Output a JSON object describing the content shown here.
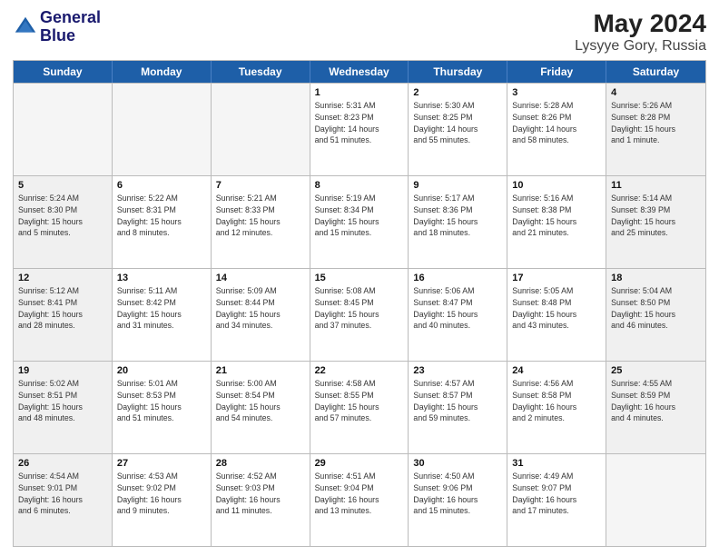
{
  "logo": {
    "line1": "General",
    "line2": "Blue"
  },
  "title": "May 2024",
  "location": "Lysyye Gory, Russia",
  "weekdays": [
    "Sunday",
    "Monday",
    "Tuesday",
    "Wednesday",
    "Thursday",
    "Friday",
    "Saturday"
  ],
  "rows": [
    [
      {
        "day": "",
        "info": "",
        "empty": true
      },
      {
        "day": "",
        "info": "",
        "empty": true
      },
      {
        "day": "",
        "info": "",
        "empty": true
      },
      {
        "day": "1",
        "info": "Sunrise: 5:31 AM\nSunset: 8:23 PM\nDaylight: 14 hours\nand 51 minutes."
      },
      {
        "day": "2",
        "info": "Sunrise: 5:30 AM\nSunset: 8:25 PM\nDaylight: 14 hours\nand 55 minutes."
      },
      {
        "day": "3",
        "info": "Sunrise: 5:28 AM\nSunset: 8:26 PM\nDaylight: 14 hours\nand 58 minutes."
      },
      {
        "day": "4",
        "info": "Sunrise: 5:26 AM\nSunset: 8:28 PM\nDaylight: 15 hours\nand 1 minute.",
        "shaded": true
      }
    ],
    [
      {
        "day": "5",
        "info": "Sunrise: 5:24 AM\nSunset: 8:30 PM\nDaylight: 15 hours\nand 5 minutes.",
        "shaded": true
      },
      {
        "day": "6",
        "info": "Sunrise: 5:22 AM\nSunset: 8:31 PM\nDaylight: 15 hours\nand 8 minutes."
      },
      {
        "day": "7",
        "info": "Sunrise: 5:21 AM\nSunset: 8:33 PM\nDaylight: 15 hours\nand 12 minutes."
      },
      {
        "day": "8",
        "info": "Sunrise: 5:19 AM\nSunset: 8:34 PM\nDaylight: 15 hours\nand 15 minutes."
      },
      {
        "day": "9",
        "info": "Sunrise: 5:17 AM\nSunset: 8:36 PM\nDaylight: 15 hours\nand 18 minutes."
      },
      {
        "day": "10",
        "info": "Sunrise: 5:16 AM\nSunset: 8:38 PM\nDaylight: 15 hours\nand 21 minutes."
      },
      {
        "day": "11",
        "info": "Sunrise: 5:14 AM\nSunset: 8:39 PM\nDaylight: 15 hours\nand 25 minutes.",
        "shaded": true
      }
    ],
    [
      {
        "day": "12",
        "info": "Sunrise: 5:12 AM\nSunset: 8:41 PM\nDaylight: 15 hours\nand 28 minutes.",
        "shaded": true
      },
      {
        "day": "13",
        "info": "Sunrise: 5:11 AM\nSunset: 8:42 PM\nDaylight: 15 hours\nand 31 minutes."
      },
      {
        "day": "14",
        "info": "Sunrise: 5:09 AM\nSunset: 8:44 PM\nDaylight: 15 hours\nand 34 minutes."
      },
      {
        "day": "15",
        "info": "Sunrise: 5:08 AM\nSunset: 8:45 PM\nDaylight: 15 hours\nand 37 minutes."
      },
      {
        "day": "16",
        "info": "Sunrise: 5:06 AM\nSunset: 8:47 PM\nDaylight: 15 hours\nand 40 minutes."
      },
      {
        "day": "17",
        "info": "Sunrise: 5:05 AM\nSunset: 8:48 PM\nDaylight: 15 hours\nand 43 minutes."
      },
      {
        "day": "18",
        "info": "Sunrise: 5:04 AM\nSunset: 8:50 PM\nDaylight: 15 hours\nand 46 minutes.",
        "shaded": true
      }
    ],
    [
      {
        "day": "19",
        "info": "Sunrise: 5:02 AM\nSunset: 8:51 PM\nDaylight: 15 hours\nand 48 minutes.",
        "shaded": true
      },
      {
        "day": "20",
        "info": "Sunrise: 5:01 AM\nSunset: 8:53 PM\nDaylight: 15 hours\nand 51 minutes."
      },
      {
        "day": "21",
        "info": "Sunrise: 5:00 AM\nSunset: 8:54 PM\nDaylight: 15 hours\nand 54 minutes."
      },
      {
        "day": "22",
        "info": "Sunrise: 4:58 AM\nSunset: 8:55 PM\nDaylight: 15 hours\nand 57 minutes."
      },
      {
        "day": "23",
        "info": "Sunrise: 4:57 AM\nSunset: 8:57 PM\nDaylight: 15 hours\nand 59 minutes."
      },
      {
        "day": "24",
        "info": "Sunrise: 4:56 AM\nSunset: 8:58 PM\nDaylight: 16 hours\nand 2 minutes."
      },
      {
        "day": "25",
        "info": "Sunrise: 4:55 AM\nSunset: 8:59 PM\nDaylight: 16 hours\nand 4 minutes.",
        "shaded": true
      }
    ],
    [
      {
        "day": "26",
        "info": "Sunrise: 4:54 AM\nSunset: 9:01 PM\nDaylight: 16 hours\nand 6 minutes.",
        "shaded": true
      },
      {
        "day": "27",
        "info": "Sunrise: 4:53 AM\nSunset: 9:02 PM\nDaylight: 16 hours\nand 9 minutes."
      },
      {
        "day": "28",
        "info": "Sunrise: 4:52 AM\nSunset: 9:03 PM\nDaylight: 16 hours\nand 11 minutes."
      },
      {
        "day": "29",
        "info": "Sunrise: 4:51 AM\nSunset: 9:04 PM\nDaylight: 16 hours\nand 13 minutes."
      },
      {
        "day": "30",
        "info": "Sunrise: 4:50 AM\nSunset: 9:06 PM\nDaylight: 16 hours\nand 15 minutes."
      },
      {
        "day": "31",
        "info": "Sunrise: 4:49 AM\nSunset: 9:07 PM\nDaylight: 16 hours\nand 17 minutes."
      },
      {
        "day": "",
        "info": "",
        "empty": true,
        "shaded": true
      }
    ]
  ]
}
